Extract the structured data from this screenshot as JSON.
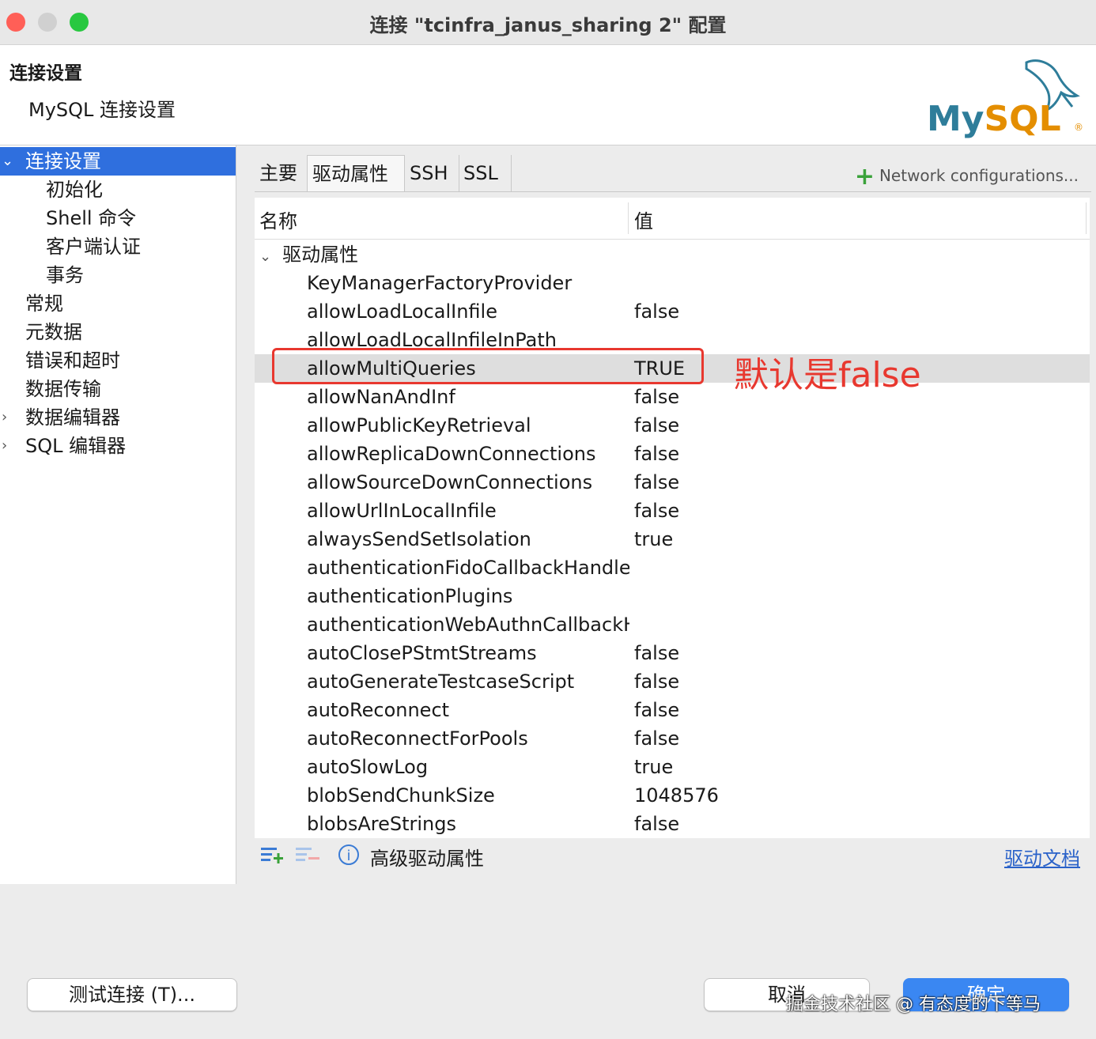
{
  "window": {
    "title": "连接 \"tcinfra_janus_sharing 2\" 配置",
    "lights": {
      "close": "#ff5f57",
      "minimize": "#d0d0d0",
      "maximize": "#28c840"
    }
  },
  "header": {
    "title": "连接设置",
    "subtitle": "MySQL 连接设置",
    "logo_text": "MySQL",
    "logo_mark": "®"
  },
  "sidebar": {
    "items": [
      {
        "label": "连接设置",
        "selected": true,
        "chevron": "⌄"
      },
      {
        "label": "初始化"
      },
      {
        "label": "Shell 命令"
      },
      {
        "label": "客户端认证"
      },
      {
        "label": "事务"
      },
      {
        "label": "常规"
      },
      {
        "label": "元数据"
      },
      {
        "label": "错误和超时"
      },
      {
        "label": "数据传输"
      },
      {
        "label": "数据编辑器",
        "chevron": "›"
      },
      {
        "label": "SQL 编辑器",
        "chevron": "›"
      }
    ]
  },
  "tabs": [
    {
      "label": "主要"
    },
    {
      "label": "驱动属性",
      "active": true
    },
    {
      "label": "SSH"
    },
    {
      "label": "SSL"
    }
  ],
  "network_config": {
    "icon": "+",
    "label": "Network configurations..."
  },
  "table": {
    "columns": [
      "名称",
      "值"
    ],
    "group": {
      "chevron": "⌄",
      "label": "驱动属性"
    },
    "rows": [
      {
        "name": "KeyManagerFactoryProvider",
        "value": ""
      },
      {
        "name": "allowLoadLocalInfile",
        "value": "false"
      },
      {
        "name": "allowLoadLocalInfileInPath",
        "value": ""
      },
      {
        "name": "allowMultiQueries",
        "value": "TRUE",
        "highlight": true
      },
      {
        "name": "allowNanAndInf",
        "value": "false"
      },
      {
        "name": "allowPublicKeyRetrieval",
        "value": "false"
      },
      {
        "name": "allowReplicaDownConnections",
        "value": "false"
      },
      {
        "name": "allowSourceDownConnections",
        "value": "false"
      },
      {
        "name": "allowUrlInLocalInfile",
        "value": "false"
      },
      {
        "name": "alwaysSendSetIsolation",
        "value": "true"
      },
      {
        "name": "authenticationFidoCallbackHandler",
        "value": ""
      },
      {
        "name": "authenticationPlugins",
        "value": ""
      },
      {
        "name": "authenticationWebAuthnCallbackHandler",
        "value": ""
      },
      {
        "name": "autoClosePStmtStreams",
        "value": "false"
      },
      {
        "name": "autoGenerateTestcaseScript",
        "value": "false"
      },
      {
        "name": "autoReconnect",
        "value": "false"
      },
      {
        "name": "autoReconnectForPools",
        "value": "false"
      },
      {
        "name": "autoSlowLog",
        "value": "true"
      },
      {
        "name": "blobSendChunkSize",
        "value": "1048576"
      },
      {
        "name": "blobsAreStrings",
        "value": "false"
      }
    ]
  },
  "annotation": {
    "text": "默认是false",
    "color": "#e8382f"
  },
  "table_footer": {
    "info_icon": "i",
    "advanced_label": "高级驱动属性",
    "doc_link": "驱动文档"
  },
  "buttons": {
    "test": "测试连接 (T)...",
    "cancel": "取消",
    "ok": "确定"
  },
  "watermark": "掘金技术社区 @ 有态度的下等马"
}
